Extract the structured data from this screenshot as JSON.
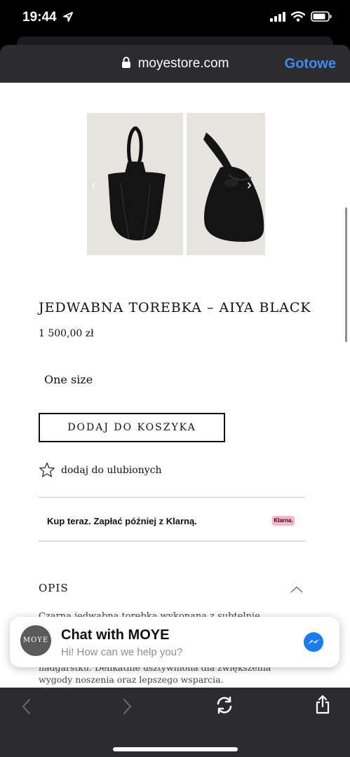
{
  "status_bar": {
    "time": "19:44"
  },
  "browser": {
    "url": "moyestore.com",
    "done_label": "Gotowe"
  },
  "product": {
    "title": "JEDWABNA TOREBKA – AIYA BLACK",
    "price": "1 500,00 zł",
    "size": "One size",
    "add_to_cart_label": "DODAJ DO KOSZYKA",
    "favorite_label": "dodaj do ulubionych"
  },
  "klarna": {
    "text": "Kup teraz. Zapłać później z Klarną.",
    "badge": "Klarna."
  },
  "description": {
    "heading": "OPIS",
    "line_partial": "Czarna jedwabna torebka wykonana z subtelnie",
    "line_2": "nadgarstku. Delikatnie usztywniona dla zwiększenia",
    "line_3": "wygody noszenia oraz lepszego wsparcia."
  },
  "chat": {
    "avatar_text": "MOYE",
    "title": "Chat with MOYE",
    "subtitle": "Hi! How can we help you?"
  },
  "colors": {
    "accent": "#3b8cf7",
    "toolbar": "#2c2c2e",
    "klarna_pink": "#ffb3c7"
  },
  "icons": [
    "location-arrow-icon",
    "signal-icon",
    "wifi-icon",
    "battery-icon",
    "lock-icon",
    "chevron-left-icon",
    "chevron-right-icon",
    "star-icon",
    "chevron-up-icon",
    "messenger-icon",
    "back-icon",
    "forward-icon",
    "reload-icon",
    "share-icon"
  ]
}
